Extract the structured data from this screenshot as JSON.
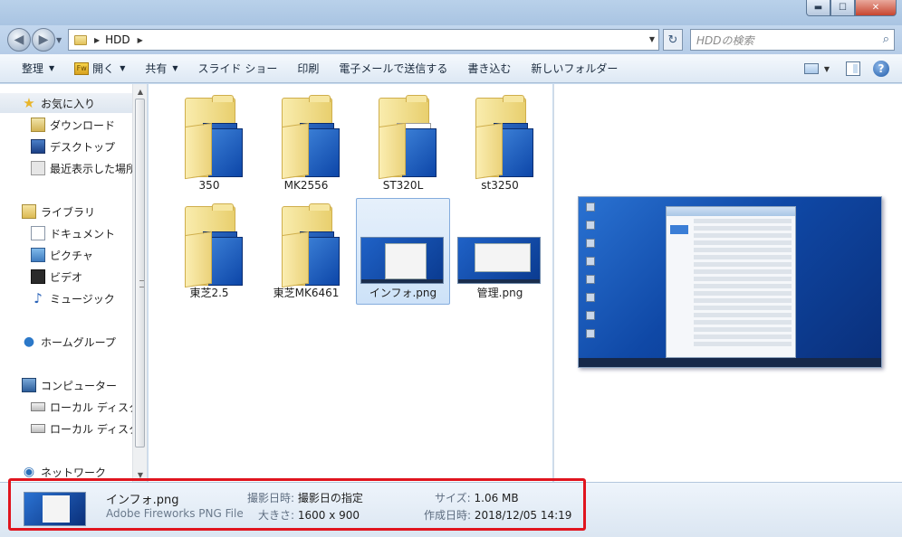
{
  "window": {
    "minimize": "▬",
    "maximize": "☐",
    "close": "✕"
  },
  "address": {
    "path": "HDD",
    "search_placeholder": "HDDの検索"
  },
  "toolbar": {
    "organize": "整理",
    "open": "開く",
    "share": "共有",
    "slideshow": "スライド ショー",
    "print": "印刷",
    "email": "電子メールで送信する",
    "burn": "書き込む",
    "new_folder": "新しいフォルダー"
  },
  "nav": {
    "favorites": "お気に入り",
    "downloads": "ダウンロード",
    "desktop": "デスクトップ",
    "recent": "最近表示した場所",
    "libraries": "ライブラリ",
    "documents": "ドキュメント",
    "pictures": "ピクチャ",
    "videos": "ビデオ",
    "music": "ミュージック",
    "homegroup": "ホームグループ",
    "computer": "コンピューター",
    "local_disk_1": "ローカル ディスク",
    "local_disk_2": "ローカル ディスク",
    "network": "ネットワーク"
  },
  "files": [
    {
      "name": "350",
      "type": "folder"
    },
    {
      "name": "MK2556",
      "type": "folder"
    },
    {
      "name": "ST320L",
      "type": "folder"
    },
    {
      "name": "st3250",
      "type": "folder"
    },
    {
      "name": "東芝2.5",
      "type": "folder"
    },
    {
      "name": "東芝MK6461",
      "type": "folder"
    },
    {
      "name": "インフォ.png",
      "type": "image",
      "selected": true
    },
    {
      "name": "管理.png",
      "type": "image"
    }
  ],
  "details": {
    "filename": "インフォ.png",
    "filetype": "Adobe Fireworks PNG File",
    "date_taken_label": "撮影日時:",
    "date_taken_value": "撮影日の指定",
    "dimensions_label": "大きさ:",
    "dimensions_value": "1600 x 900",
    "size_label": "サイズ:",
    "size_value": "1.06 MB",
    "created_label": "作成日時:",
    "created_value": "2018/12/05 14:19"
  },
  "colors": {
    "highlight_border": "#e0141e",
    "selection_bg": "#cde2f8",
    "window_frame": "#c9dcef"
  }
}
